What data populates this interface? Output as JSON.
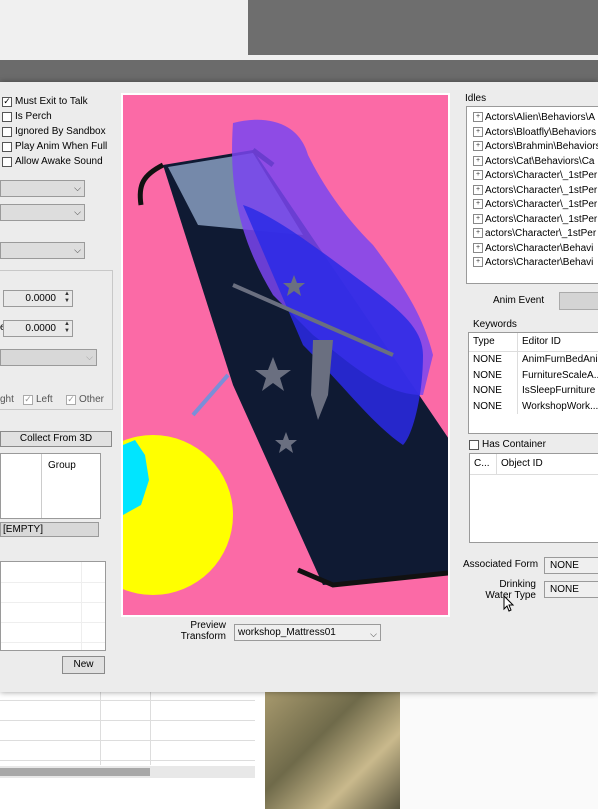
{
  "left": {
    "checkboxes": [
      {
        "label": "Must Exit to Talk",
        "checked": true
      },
      {
        "label": "Is Perch",
        "checked": false
      },
      {
        "label": "Ignored By Sandbox",
        "checked": false
      },
      {
        "label": "Play Anim When Full",
        "checked": false
      },
      {
        "label": "Allow Awake Sound",
        "checked": false
      }
    ],
    "spin1": "0.0000",
    "spin2": "0.0000",
    "spin2_label": "e",
    "check_right_label": "ght",
    "check_left_label": "Left",
    "check_other_label": "Other",
    "collect_button": "Collect From 3D",
    "group_header": "Group",
    "empty_label": "[EMPTY]",
    "new_button": "New"
  },
  "preview": {
    "label_line1": "Preview",
    "label_line2": "Transform",
    "transform_value": "workshop_Mattress01"
  },
  "right": {
    "idles_title": "Idles",
    "idles": [
      "Actors\\Alien\\Behaviors\\A",
      "Actors\\Bloatfly\\Behaviors",
      "Actors\\Brahmin\\Behaviors",
      "Actors\\Cat\\Behaviors\\Ca",
      "Actors\\Character\\_1stPer",
      "Actors\\Character\\_1stPer",
      "Actors\\Character\\_1stPer",
      "Actors\\Character\\_1stPer",
      "actors\\Character\\_1stPer",
      "Actors\\Character\\Behavi",
      "Actors\\Character\\Behavi"
    ],
    "anim_event_label": "Anim Event",
    "keywords_title": "Keywords",
    "keywords_headers": [
      "Type",
      "Editor ID"
    ],
    "keywords": [
      {
        "type": "NONE",
        "editor_id": "AnimFurnBedAni..."
      },
      {
        "type": "NONE",
        "editor_id": "FurnitureScaleA..."
      },
      {
        "type": "NONE",
        "editor_id": "IsSleepFurniture"
      },
      {
        "type": "NONE",
        "editor_id": "WorkshopWork..."
      }
    ],
    "has_container_label": "Has Container",
    "container_headers": [
      "C...",
      "Object ID"
    ],
    "associated_form_label": "Associated Form",
    "associated_form_value": "NONE",
    "drinking_label_1": "Drinking",
    "drinking_label_2": "Water Type",
    "drinking_value": "NONE"
  },
  "colors": {
    "preview_bg": "#fb6aa6",
    "mattress": "#0f1a33",
    "figure_purple": "#7a45f0",
    "figure_blue": "#2a2ae6",
    "sphere_yellow": "#ffff00",
    "sphere_cyan": "#00e5ff"
  }
}
